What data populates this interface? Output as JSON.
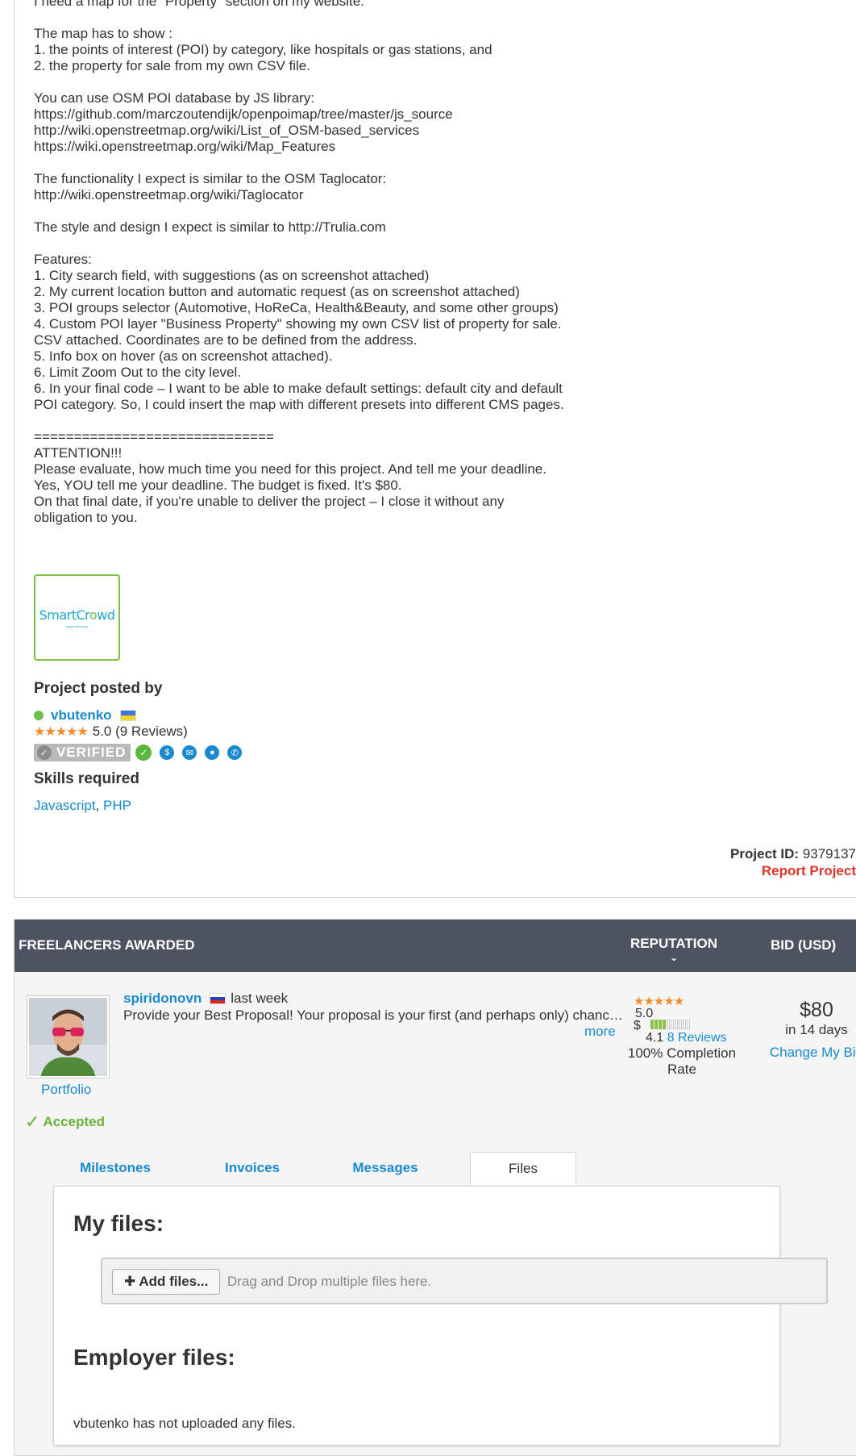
{
  "description": "I need a map for the \"Property\" section on my website.\n\nThe map has to show :\n1. the points of interest (POI) by category, like hospitals or gas stations, and\n2. the property for sale from my own CSV file.\n\nYou can use OSM POI database by JS library:\nhttps://github.com/marczoutendijk/openpoimap/tree/master/js_source\nhttp://wiki.openstreetmap.org/wiki/List_of_OSM-based_services\nhttps://wiki.openstreetmap.org/wiki/Map_Features\n\nThe functionality I expect is similar to the OSM Taglocator:\nhttp://wiki.openstreetmap.org/wiki/Taglocator\n\nThe style and design I expect is similar to http://Trulia.com\n\nFeatures:\n1. City search field, with suggestions (as on screenshot attached)\n2. My current location button and automatic request (as on screenshot attached)\n3. POI groups selector (Automotive, HoReCa, Health&Beauty, and some other groups)\n4. Custom POI layer \"Business Property\" showing my own CSV list of property for sale. CSV attached. Coordinates are to be defined from the address.\n5. Info box on hover (as on screenshot attached).\n6. Limit Zoom Out to the city level.\n6. In your final code – I want to be able to make default settings: default city and default POI category. So, I could insert the map with different presets into different CMS pages.\n\n==============================\nATTENTION!!!\nPlease evaluate, how much time you need for this project. And tell me your deadline. Yes, YOU tell me your deadline. The budget is fixed. It's $80.\nOn that final date, if you're unable to deliver the project – I close it without any obligation to you.",
  "attachment": {
    "logo_text_a": "SmartCr",
    "logo_text_b": "o",
    "logo_text_c": "wd",
    "logo_sub": "expert directory"
  },
  "poster": {
    "section_title": "Project posted by",
    "username": "vbutenko",
    "rating": "5.0",
    "reviews": "(9 Reviews)",
    "stars": "★★★★★",
    "verified_label": "VERIFIED"
  },
  "skills": {
    "section_title": "Skills required",
    "items": [
      "Javascript",
      "PHP"
    ],
    "separator": ", "
  },
  "project": {
    "id_label": "Project ID:",
    "id_value": "9379137",
    "report_label": "Report Project"
  },
  "awarded": {
    "header_freelancers": "FREELANCERS AWARDED",
    "header_reputation": "REPUTATION",
    "header_bid": "BID (USD)",
    "bidder": {
      "username": "spiridonovn",
      "time": "last week",
      "proposal": "Provide your Best Proposal! Your proposal is your first (and perhaps only) chance to impress the employer",
      "more_label": "more",
      "portfolio_label": "Portfolio",
      "status_label": "Accepted",
      "stars": "★★★★★",
      "rating": "5.0",
      "currency": "$",
      "earnings_score": "4.1",
      "earnings_level": 0.4,
      "reviews": "8 Reviews",
      "completion": "100% Completion Rate",
      "bid_amount": "$80",
      "bid_days": "in 14 days",
      "change_bid": "Change My Bid"
    },
    "tabs": [
      {
        "label": "Milestones",
        "active": false
      },
      {
        "label": "Invoices",
        "active": false
      },
      {
        "label": "Messages",
        "active": false
      },
      {
        "label": "Files",
        "active": true
      }
    ],
    "files": {
      "my_files_title": "My files:",
      "add_files_label": "Add files...",
      "drop_hint": "Drag and Drop multiple files here.",
      "employer_files_title": "Employer files:",
      "employer_empty": "vbutenko has not uploaded any files."
    }
  }
}
